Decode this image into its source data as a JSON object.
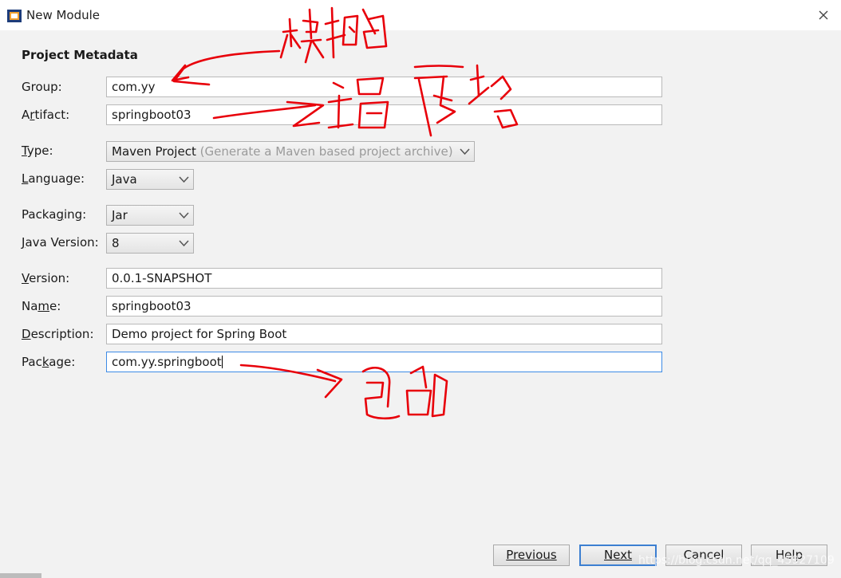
{
  "window": {
    "title": "New Module"
  },
  "section": {
    "title": "Project Metadata"
  },
  "labels": {
    "group": "Group:",
    "artifact_prefix": "A",
    "artifact_u": "r",
    "artifact_rest": "tifact:",
    "type_u": "T",
    "type_rest": "ype:",
    "language_u": "L",
    "language_rest": "anguage:",
    "packaging_pre": "Packa",
    "packaging_u": "g",
    "packaging_rest": "ing:",
    "java_u": "J",
    "java_rest": "ava Version:",
    "version_u": "V",
    "version_rest": "ersion:",
    "name_pre": "Na",
    "name_u": "m",
    "name_rest": "e:",
    "desc_u": "D",
    "desc_rest": "escription:",
    "package_pre": "Pac",
    "package_u": "k",
    "package_rest": "age:"
  },
  "fields": {
    "group": "com.yy",
    "artifact": "springboot03",
    "version": "0.0.1-SNAPSHOT",
    "name": "springboot03",
    "description": "Demo project for Spring Boot",
    "package": "com.yy.springboot"
  },
  "selects": {
    "type": "Maven Project",
    "type_hint": "(Generate a Maven based project archive)",
    "language": "Java",
    "packaging": "Jar",
    "java_version": "8"
  },
  "buttons": {
    "previous": "Previous",
    "next": "Next",
    "cancel": "Cancel",
    "help": "Help"
  },
  "watermark": "https://blog.csdn.net/qq_45927109",
  "colors": {
    "annotation": "#e8000a",
    "focus_border": "#3d8be6",
    "default_button_border": "#3c7fd1"
  }
}
